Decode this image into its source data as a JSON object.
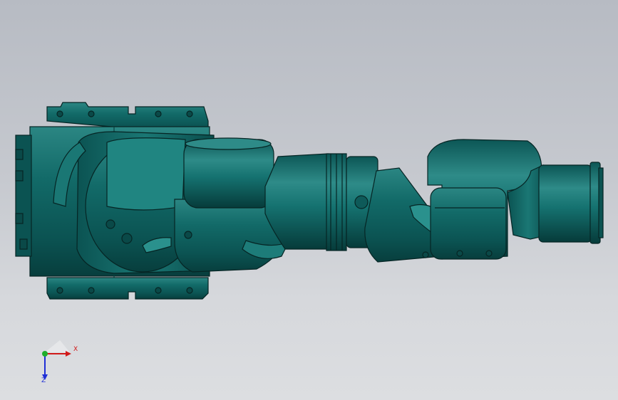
{
  "viewport": {
    "background_top": "#b7bbc3",
    "background_bottom": "#dcdee1"
  },
  "model": {
    "body_color": "#0f5f5e",
    "edge_color": "#062524",
    "highlight_color": "#2f8a86"
  },
  "triad": {
    "x_label": "X",
    "z_label": "Z",
    "x_color": "#d11a1a",
    "z_color": "#1f2fd6",
    "y_color": "#1fae2a"
  }
}
